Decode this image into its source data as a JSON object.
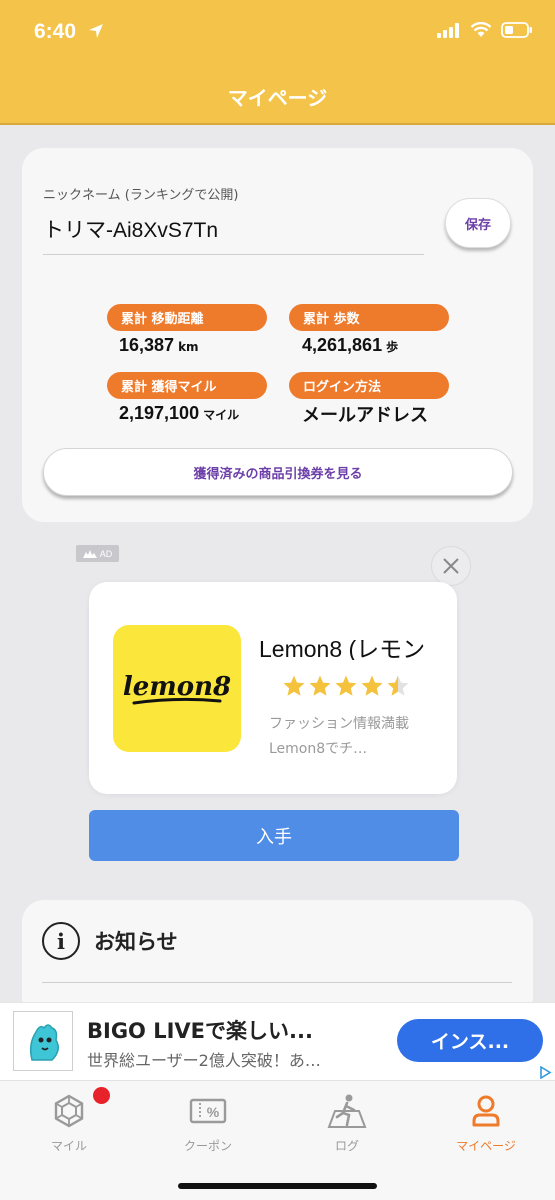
{
  "status_bar": {
    "time": "6:40"
  },
  "header": {
    "title": "マイページ"
  },
  "profile": {
    "nickname_label": "ニックネーム (ランキングで公開)",
    "nickname_value": "トリマ-Ai8XvS7Tn",
    "save_label": "保存",
    "stats": [
      {
        "label": "累計 移動距離",
        "value": "16,387",
        "unit": "km"
      },
      {
        "label": "累計 歩数",
        "value": "4,261,861",
        "unit": "歩"
      },
      {
        "label": "累計 獲得マイル",
        "value": "2,197,100",
        "unit": "マイル"
      },
      {
        "label": "ログイン方法",
        "value": "メールアドレス",
        "unit": ""
      }
    ],
    "voucher_button": "獲得済みの商品引換券を見る"
  },
  "ad": {
    "tag": "AD",
    "app_icon_text": "lemon8",
    "app_title": "Lemon8 (レモン",
    "rating": 4.5,
    "description": "ファッション情報満載　Lemon8でチ…",
    "get_button": "入手"
  },
  "notice": {
    "title": "お知らせ"
  },
  "banner_ad": {
    "title": "BIGO LIVEで楽しい...",
    "subtitle": "世界総ユーザー2億人突破！あ…",
    "button": "インス..."
  },
  "tabs": [
    {
      "label": "マイル",
      "icon": "mile-icon",
      "active": false
    },
    {
      "label": "クーポン",
      "icon": "coupon-icon",
      "active": false
    },
    {
      "label": "ログ",
      "icon": "log-icon",
      "active": false
    },
    {
      "label": "マイページ",
      "icon": "mypage-icon",
      "active": true
    }
  ],
  "colors": {
    "header": "#f3c34a",
    "accent_orange": "#ee7a2c",
    "accent_purple": "#6c3fa8",
    "ad_blue": "#4f8de6"
  }
}
